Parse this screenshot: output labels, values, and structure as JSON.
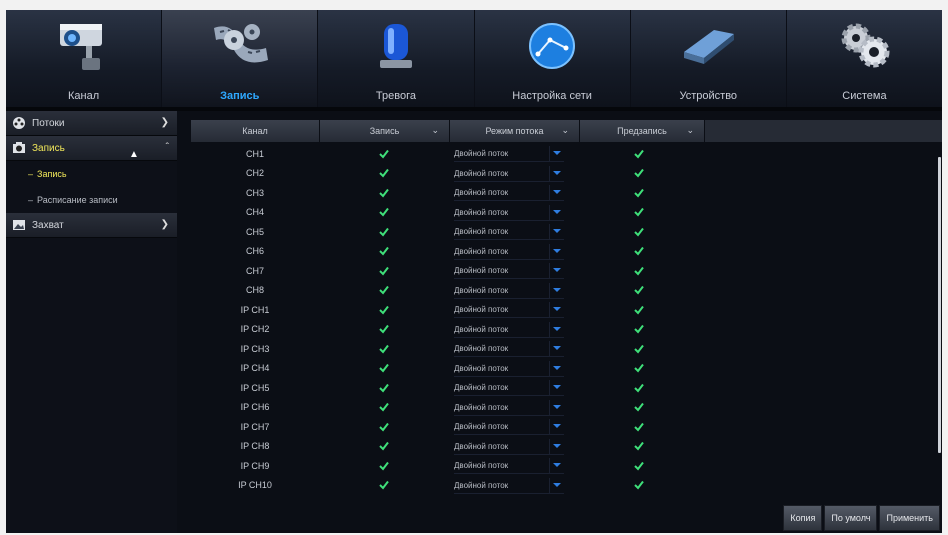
{
  "tabs": [
    {
      "label": "Канал",
      "icon": "camera-icon",
      "active": false
    },
    {
      "label": "Запись",
      "icon": "film-reel-icon",
      "active": true
    },
    {
      "label": "Тревога",
      "icon": "alarm-siren-icon",
      "active": false
    },
    {
      "label": "Настройка сети",
      "icon": "network-globe-icon",
      "active": false
    },
    {
      "label": "Устройство",
      "icon": "hard-drive-icon",
      "active": false
    },
    {
      "label": "Система",
      "icon": "gears-icon",
      "active": false
    }
  ],
  "sidebar": {
    "groups": [
      {
        "label": "Потоки",
        "icon": "stream-reel-icon",
        "open": false
      },
      {
        "label": "Запись",
        "icon": "record-icon",
        "open": true
      },
      {
        "label": "Захват",
        "icon": "capture-image-icon",
        "open": false
      }
    ],
    "subitems": [
      {
        "label": "Запись",
        "active": true
      },
      {
        "label": "Расписание записи",
        "active": false
      }
    ]
  },
  "table": {
    "headers": {
      "channel": "Канал",
      "record": "Запись",
      "stream_mode": "Режим потока",
      "prerecord": "Предзапись"
    },
    "rows": [
      {
        "channel": "CH1",
        "mode": "Двойной поток"
      },
      {
        "channel": "CH2",
        "mode": "Двойной поток"
      },
      {
        "channel": "CH3",
        "mode": "Двойной поток"
      },
      {
        "channel": "CH4",
        "mode": "Двойной поток"
      },
      {
        "channel": "CH5",
        "mode": "Двойной поток"
      },
      {
        "channel": "CH6",
        "mode": "Двойной поток"
      },
      {
        "channel": "CH7",
        "mode": "Двойной поток"
      },
      {
        "channel": "CH8",
        "mode": "Двойной поток"
      },
      {
        "channel": "IP CH1",
        "mode": "Двойной поток"
      },
      {
        "channel": "IP CH2",
        "mode": "Двойной поток"
      },
      {
        "channel": "IP CH3",
        "mode": "Двойной поток"
      },
      {
        "channel": "IP CH4",
        "mode": "Двойной поток"
      },
      {
        "channel": "IP CH5",
        "mode": "Двойной поток"
      },
      {
        "channel": "IP CH6",
        "mode": "Двойной поток"
      },
      {
        "channel": "IP CH7",
        "mode": "Двойной поток"
      },
      {
        "channel": "IP CH8",
        "mode": "Двойной поток"
      },
      {
        "channel": "IP CH9",
        "mode": "Двойной поток"
      },
      {
        "channel": "IP CH10",
        "mode": "Двойной поток"
      }
    ]
  },
  "buttons": {
    "copy": "Копия",
    "default": "По умолч",
    "apply": "Применить"
  },
  "colors": {
    "accent": "#2ea8ff",
    "sidebar_active": "#f2e85a",
    "check": "#3fe07a"
  }
}
